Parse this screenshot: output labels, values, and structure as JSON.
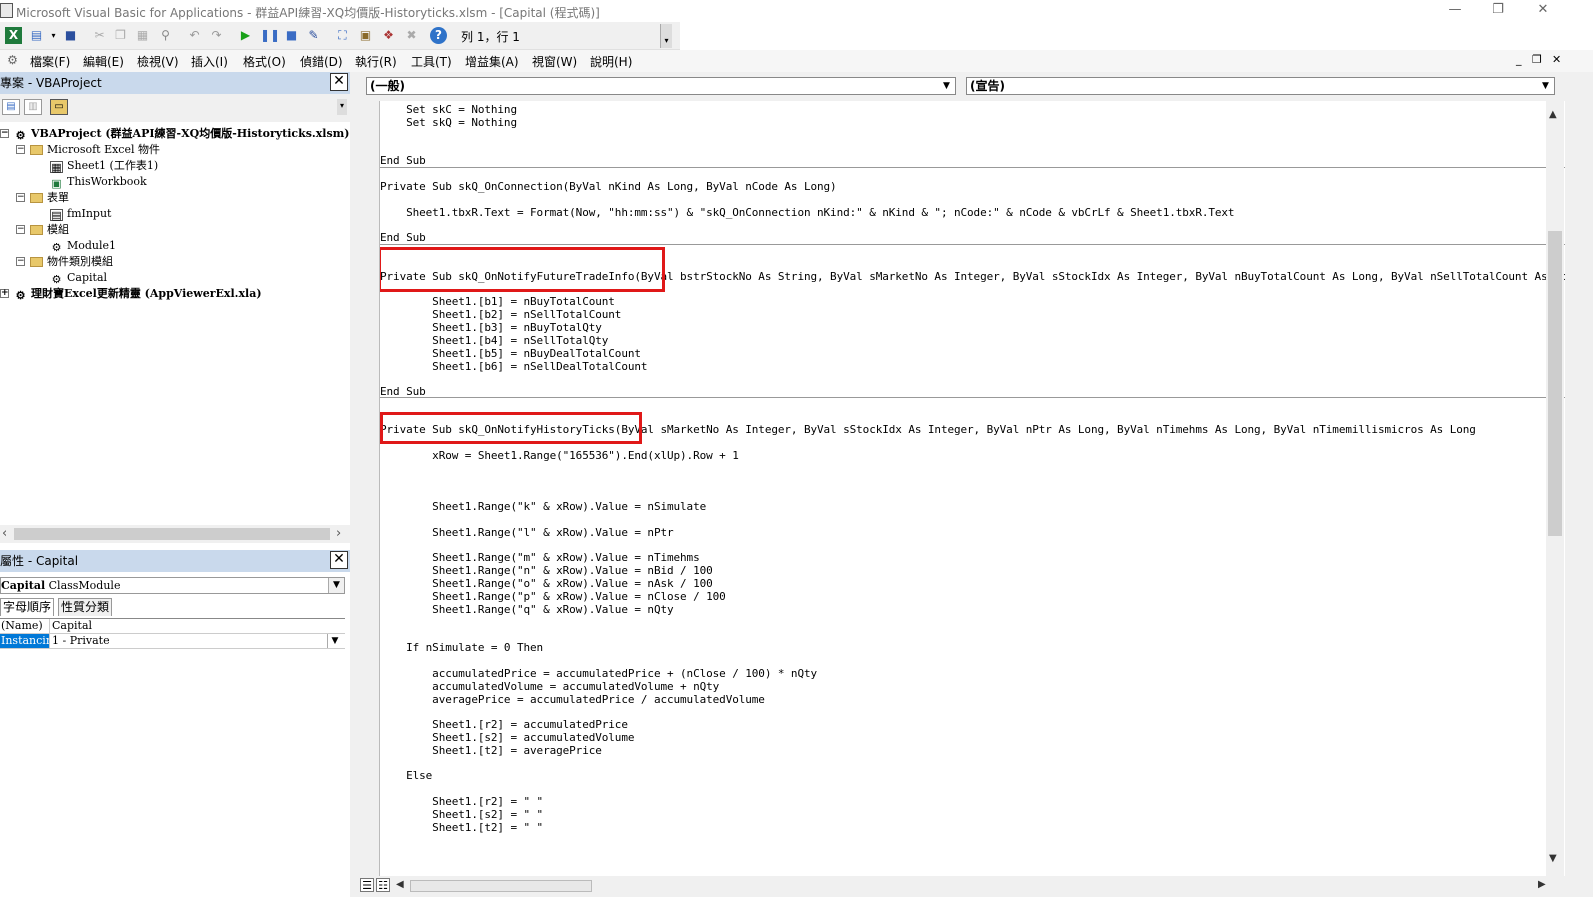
{
  "window": {
    "title": "Microsoft Visual Basic for Applications - 群益API練習-XQ均價版-Historyticks.xlsm - [Capital (程式碼)]",
    "minimize": "—",
    "restore": "❐",
    "close": "✕"
  },
  "toolbar": {
    "position": "列 1，行 1"
  },
  "menu": [
    "檔案(F)",
    "編輯(E)",
    "檢視(V)",
    "插入(I)",
    "格式(O)",
    "偵錯(D)",
    "執行(R)",
    "工具(T)",
    "增益集(A)",
    "視窗(W)",
    "說明(H)"
  ],
  "mdi_controls": {
    "minimize": "_",
    "restore": "❐",
    "close": "✕"
  },
  "project": {
    "title": "專案 - VBAProject",
    "close": "✕",
    "tree": [
      {
        "label": "VBAProject (群益API練習-XQ均價版-Historyticks.xlsm)",
        "bold": true
      },
      {
        "label": "Microsoft Excel 物件"
      },
      {
        "label": "Sheet1 (工作表1)"
      },
      {
        "label": "ThisWorkbook"
      },
      {
        "label": "表單"
      },
      {
        "label": "fmInput"
      },
      {
        "label": "模組"
      },
      {
        "label": "Module1"
      },
      {
        "label": "物件類別模組"
      },
      {
        "label": "Capital"
      },
      {
        "label": "理財寶Excel更新精靈 (AppViewerExl.xla)",
        "bold": true
      }
    ]
  },
  "properties": {
    "title": "屬性 - Capital",
    "close": "✕",
    "object_name": "Capital",
    "object_type": "ClassModule",
    "tabs": [
      "字母順序",
      "性質分類"
    ],
    "rows": [
      {
        "name": "(Name)",
        "value": "Capital"
      },
      {
        "name": "Instancing",
        "value": "1 - Private"
      }
    ]
  },
  "code": {
    "object_combo": "(一般)",
    "procedure_combo": "(宣告)",
    "lines": [
      "    Set skC = Nothing",
      "    Set skQ = Nothing",
      "",
      "End Sub",
      "Private Sub skQ_OnConnection(ByVal nKind As Long, ByVal nCode As Long)",
      "",
      "    Sheet1.tbxR.Text = Format(Now, \"hh:mm:ss\") & \"skQ_OnConnection nKind:\" & nKind & \"; nCode:\" & nCode & vbCrLf & Sheet1.tbxR.Text",
      "",
      "End Sub",
      "",
      "Private Sub skQ_OnNotifyFutureTradeInfo(ByVal bstrStockNo As String, ByVal sMarketNo As Integer, ByVal sStockIdx As Integer, ByVal nBuyTotalCount As Long, ByVal nSellTotalCount As Long",
      "",
      "        Sheet1.[b1] = nBuyTotalCount",
      "        Sheet1.[b2] = nSellTotalCount",
      "        Sheet1.[b3] = nBuyTotalQty",
      "        Sheet1.[b4] = nSellTotalQty",
      "        Sheet1.[b5] = nBuyDealTotalCount",
      "        Sheet1.[b6] = nSellDealTotalCount",
      "",
      "End Sub",
      "",
      "Private Sub skQ_OnNotifyHistoryTicks(ByVal sMarketNo As Integer, ByVal sStockIdx As Integer, ByVal nPtr As Long, ByVal nTimehms As Long, ByVal nTimemillismicros As Long",
      "",
      "        xRow = Sheet1.Range(\"165536\").End(xlUp).Row + 1",
      "",
      "",
      "",
      "        Sheet1.Range(\"k\" & xRow).Value = nSimulate",
      "",
      "        Sheet1.Range(\"l\" & xRow).Value = nPtr",
      "",
      "        Sheet1.Range(\"m\" & xRow).Value = nTimehms",
      "        Sheet1.Range(\"n\" & xRow).Value = nBid / 100",
      "        Sheet1.Range(\"o\" & xRow).Value = nAsk / 100",
      "        Sheet1.Range(\"p\" & xRow).Value = nClose / 100",
      "        Sheet1.Range(\"q\" & xRow).Value = nQty",
      "",
      "",
      "    If nSimulate = 0 Then",
      "",
      "        accumulatedPrice = accumulatedPrice + (nClose / 100) * nQty",
      "        accumulatedVolume = accumulatedVolume + nQty",
      "        averagePrice = accumulatedPrice / accumulatedVolume",
      "",
      "        Sheet1.[r2] = accumulatedPrice",
      "        Sheet1.[s2] = accumulatedVolume",
      "        Sheet1.[t2] = averagePrice",
      "",
      "    Else",
      "",
      "        Sheet1.[r2] = \" \"",
      "        Sheet1.[s2] = \" \"",
      "        Sheet1.[t2] = \" \""
    ]
  },
  "highlights": [
    "Private Sub skQ_OnNotifyFutureTradeInfo",
    "Private Sub skQ_OnNotifyHistoryTicks"
  ],
  "colors": {
    "highlight": "#e01818",
    "selection": "#0078d7",
    "panel_title": "#c9d9ec"
  }
}
